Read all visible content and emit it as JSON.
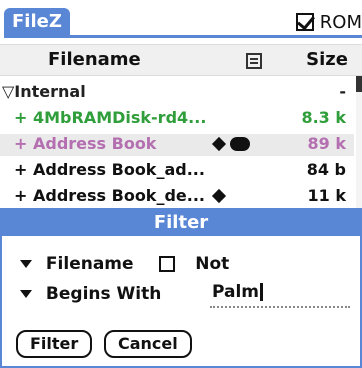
{
  "app": {
    "title": "FileZ",
    "card_label": "ROM"
  },
  "columns": {
    "filename": "Filename",
    "attr_icon": "list-icon",
    "size": "Size"
  },
  "files": [
    {
      "kind": "group",
      "name": "▽Internal",
      "size": "-",
      "color": "#222222",
      "attrs": []
    },
    {
      "kind": "file",
      "name": "+ 4MbRAMDisk-rd4...",
      "size": "8.3 k",
      "color": "#2f9e3b",
      "attrs": []
    },
    {
      "kind": "file",
      "name": "+ Address Book",
      "size": "89 k",
      "color": "#b46fb0",
      "attrs": [
        "diamond-icon",
        "pill-icon"
      ]
    },
    {
      "kind": "file",
      "name": "+ Address Book_ad...",
      "size": "84 b",
      "color": "#111111",
      "attrs": []
    },
    {
      "kind": "file",
      "name": "+ Address Book_de...",
      "size": "11 k",
      "color": "#111111",
      "attrs": [
        "diamond-icon"
      ]
    }
  ],
  "dialog": {
    "title": "Filter",
    "field_label": "Filename",
    "not_label": "Not",
    "match_label": "Begins With",
    "match_value": "Palm",
    "filter_button": "Filter",
    "cancel_button": "Cancel"
  }
}
